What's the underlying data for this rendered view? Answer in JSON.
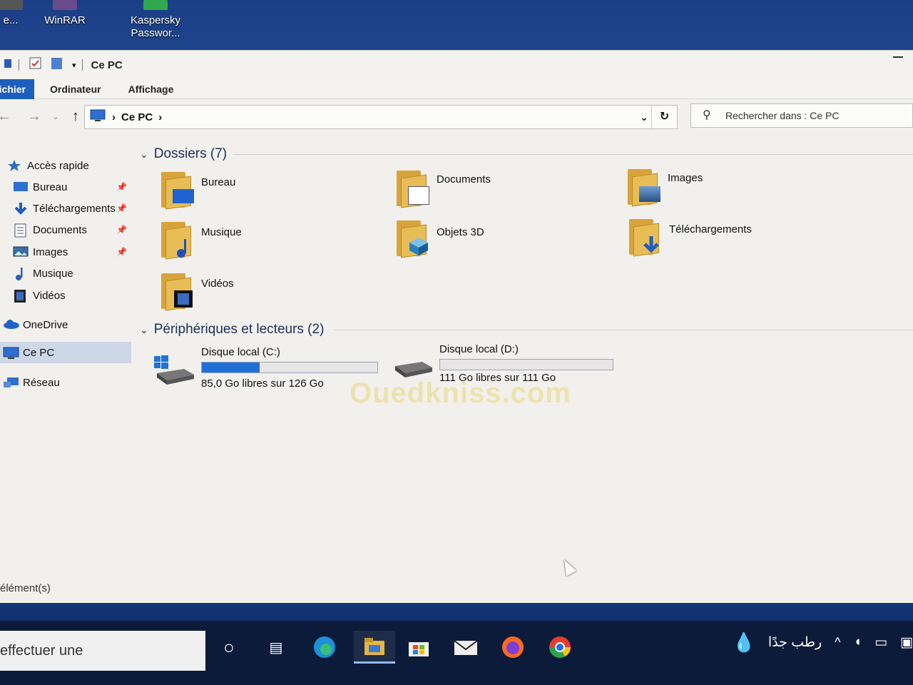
{
  "desktop": {
    "icons": [
      {
        "label": "e...",
        "icon": "app-icon"
      },
      {
        "label": "WinRAR",
        "icon": "winrar-icon"
      },
      {
        "label": "Kaspersky Passwor...",
        "icon": "kaspersky-icon"
      }
    ]
  },
  "window": {
    "title": "Ce PC",
    "ribbon": {
      "file_tab": "Fichier",
      "tabs": [
        "Ordinateur",
        "Affichage"
      ]
    },
    "address": {
      "location": "Ce PC"
    },
    "search": {
      "placeholder": "Rechercher dans : Ce PC"
    },
    "status": "élément(s)"
  },
  "sidebar": {
    "items": [
      {
        "label": "Accès rapide",
        "icon": "star-icon",
        "pinned": false
      },
      {
        "label": "Bureau",
        "icon": "desktop-icon",
        "pinned": true
      },
      {
        "label": "Téléchargements",
        "icon": "download-icon",
        "pinned": true
      },
      {
        "label": "Documents",
        "icon": "document-icon",
        "pinned": true
      },
      {
        "label": "Images",
        "icon": "image-icon",
        "pinned": true
      },
      {
        "label": "Musique",
        "icon": "music-icon",
        "pinned": false
      },
      {
        "label": "Vidéos",
        "icon": "video-icon",
        "pinned": false
      },
      {
        "label": "OneDrive",
        "icon": "cloud-icon",
        "pinned": false
      },
      {
        "label": "Ce PC",
        "icon": "computer-icon",
        "pinned": false,
        "selected": true
      },
      {
        "label": "Réseau",
        "icon": "network-icon",
        "pinned": false
      }
    ]
  },
  "folders": {
    "header": "Dossiers (7)",
    "items": [
      {
        "label": "Bureau",
        "icon": "desktop-folder-icon"
      },
      {
        "label": "Documents",
        "icon": "documents-folder-icon"
      },
      {
        "label": "Images",
        "icon": "pictures-folder-icon"
      },
      {
        "label": "Musique",
        "icon": "music-folder-icon"
      },
      {
        "label": "Objets 3D",
        "icon": "3d-objects-folder-icon"
      },
      {
        "label": "Téléchargements",
        "icon": "downloads-folder-icon"
      },
      {
        "label": "Vidéos",
        "icon": "videos-folder-icon"
      }
    ]
  },
  "drives": {
    "header": "Périphériques et lecteurs (2)",
    "items": [
      {
        "label": "Disque local (C:)",
        "size_text": "85,0 Go libres sur 126 Go",
        "used_fraction": 0.33,
        "icon": "windows-drive-icon"
      },
      {
        "label": "Disque local (D:)",
        "size_text": "111 Go libres sur 111 Go",
        "used_fraction": 0.0,
        "icon": "drive-icon"
      }
    ]
  },
  "watermark": "Ouedkniss.com",
  "taskbar": {
    "search_text": "effectuer une",
    "weather": "رطب جدًا",
    "colors": {
      "accent": "#1f6fd6",
      "taskbar": "#0d1b3a"
    }
  }
}
